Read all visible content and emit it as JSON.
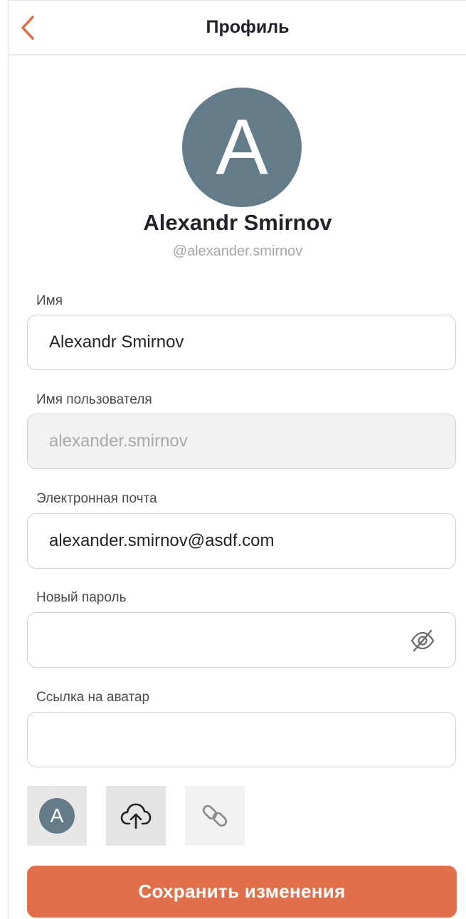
{
  "header": {
    "title": "Профиль",
    "back_icon": "chevron-left-icon",
    "accent_color": "#e16f49"
  },
  "profile": {
    "avatar_letter": "A",
    "avatar_color": "#647b89",
    "name": "Alexandr Smirnov",
    "handle": "@alexander.smirnov"
  },
  "form": {
    "name": {
      "label": "Имя",
      "value": "Alexandr Smirnov"
    },
    "username": {
      "label": "Имя пользователя",
      "value": "alexander.smirnov",
      "disabled": true
    },
    "email": {
      "label": "Электронная почта",
      "value": "alexander.smirnov@asdf.com"
    },
    "password": {
      "label": "Новый пароль",
      "value": "",
      "toggle_icon": "eye-off-icon"
    },
    "avatar_link": {
      "label": "Ссылка на аватар",
      "value": ""
    }
  },
  "avatar_options": [
    {
      "icon": "avatar-letter-icon",
      "letter": "A"
    },
    {
      "icon": "cloud-upload-icon"
    },
    {
      "icon": "link-icon"
    }
  ],
  "save_button": {
    "label": "Сохранить изменения",
    "color": "#e16f49"
  }
}
